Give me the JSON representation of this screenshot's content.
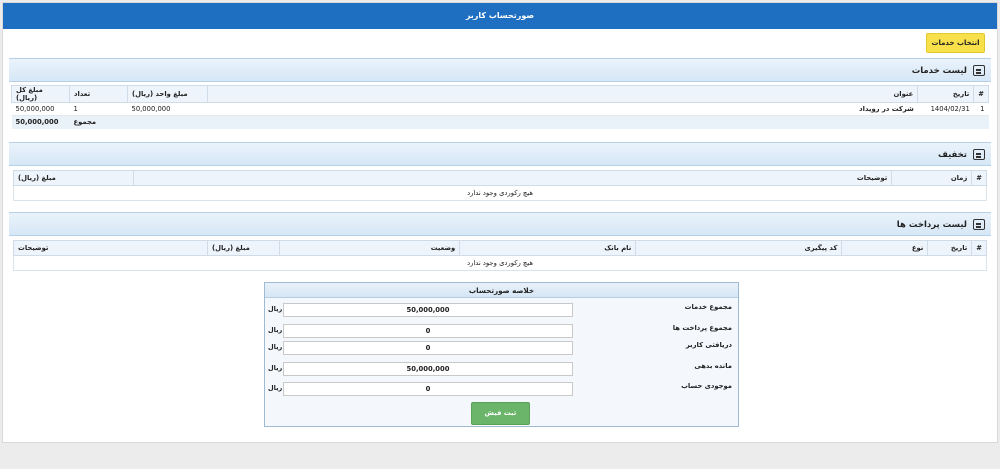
{
  "window": {
    "title": "صورتحساب کاربر"
  },
  "toolbar": {
    "select_services_label": "انتخاب خدمات"
  },
  "services": {
    "title": "لیست خدمات",
    "columns": [
      "#",
      "تاریخ",
      "عنوان",
      "مبلغ واحد (ریال)",
      "تعداد",
      "مبلغ کل (ریال)"
    ],
    "rows": [
      {
        "index": "1",
        "date": "1404/02/31",
        "title": "شرکت در رویداد",
        "unit_price": "50,000,000",
        "count": "1",
        "total": "50,000,000"
      }
    ],
    "footer": {
      "label": "مجموع",
      "value": "50,000,000"
    }
  },
  "discount": {
    "title": "تخفیف",
    "columns": [
      "#",
      "زمان",
      "توضیحات",
      "مبلغ (ریال)"
    ],
    "empty": "هیچ رکوردی وجود ندارد"
  },
  "payments": {
    "title": "لیست پرداخت ها",
    "columns": [
      "#",
      "تاریخ",
      "نوع",
      "کد پیگیری",
      "نام بانک",
      "وضعیت",
      "مبلغ (ریال)",
      "توضیحات"
    ],
    "empty": "هیچ رکوردی وجود ندارد"
  },
  "summary": {
    "title": "خلاصه صورتحساب",
    "unit": "ریال",
    "rows": [
      {
        "label": "مجموع خدمات",
        "value": "50,000,000"
      },
      {
        "label": "مجموع پرداخت ها",
        "value": "0"
      },
      {
        "label": "دریافتی کاربر",
        "value": "0"
      },
      {
        "label": "مانده بدهی",
        "value": "50,000,000"
      },
      {
        "label": "موجودی حساب",
        "value": "0"
      }
    ],
    "submit_label": "ثبت فیش"
  },
  "colors": {
    "titlebar": "#1e6fc1",
    "select_button": "#f8e04a",
    "submit_button": "#6bb56b"
  }
}
